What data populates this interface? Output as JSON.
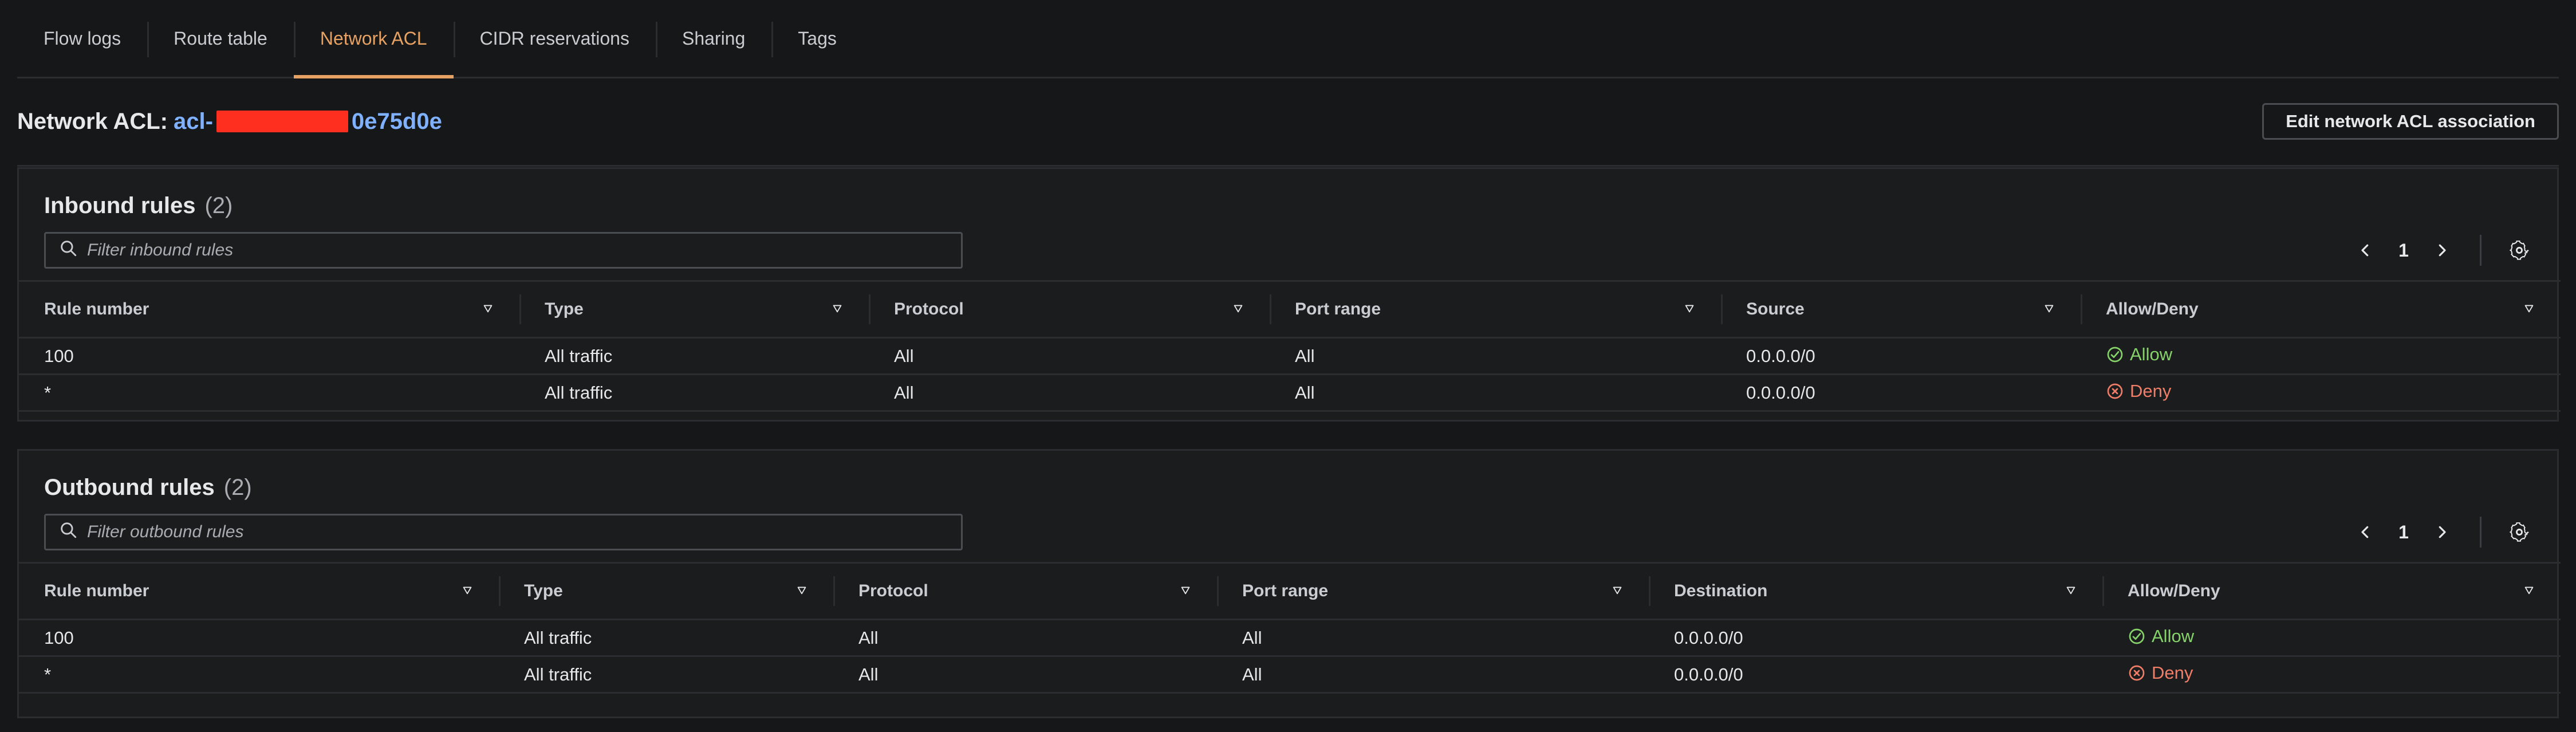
{
  "tabs": [
    {
      "label": "Flow logs",
      "active": false
    },
    {
      "label": "Route table",
      "active": false
    },
    {
      "label": "Network ACL",
      "active": true
    },
    {
      "label": "CIDR reservations",
      "active": false
    },
    {
      "label": "Sharing",
      "active": false
    },
    {
      "label": "Tags",
      "active": false
    }
  ],
  "header": {
    "title_prefix": "Network ACL:",
    "acl_prefix": "acl-",
    "acl_suffix": "0e75d0e",
    "edit_button_label": "Edit network ACL association"
  },
  "inbound": {
    "title": "Inbound rules",
    "count": "(2)",
    "filter_placeholder": "Filter inbound rules",
    "page": "1",
    "columns": [
      "Rule number",
      "Type",
      "Protocol",
      "Port range",
      "Source",
      "Allow/Deny"
    ],
    "rows": [
      {
        "rule": "100",
        "type": "All traffic",
        "protocol": "All",
        "port_range": "All",
        "cidr": "0.0.0.0/0",
        "action": "Allow"
      },
      {
        "rule": "*",
        "type": "All traffic",
        "protocol": "All",
        "port_range": "All",
        "cidr": "0.0.0.0/0",
        "action": "Deny"
      }
    ]
  },
  "outbound": {
    "title": "Outbound rules",
    "count": "(2)",
    "filter_placeholder": "Filter outbound rules",
    "page": "1",
    "columns": [
      "Rule number",
      "Type",
      "Protocol",
      "Port range",
      "Destination",
      "Allow/Deny"
    ],
    "rows": [
      {
        "rule": "100",
        "type": "All traffic",
        "protocol": "All",
        "port_range": "All",
        "cidr": "0.0.0.0/0",
        "action": "Allow"
      },
      {
        "rule": "*",
        "type": "All traffic",
        "protocol": "All",
        "port_range": "All",
        "cidr": "0.0.0.0/0",
        "action": "Deny"
      }
    ]
  },
  "colors": {
    "accent": "#e7a163",
    "link": "#7fb1ff",
    "allow": "#86d36a",
    "deny": "#f07d67"
  }
}
